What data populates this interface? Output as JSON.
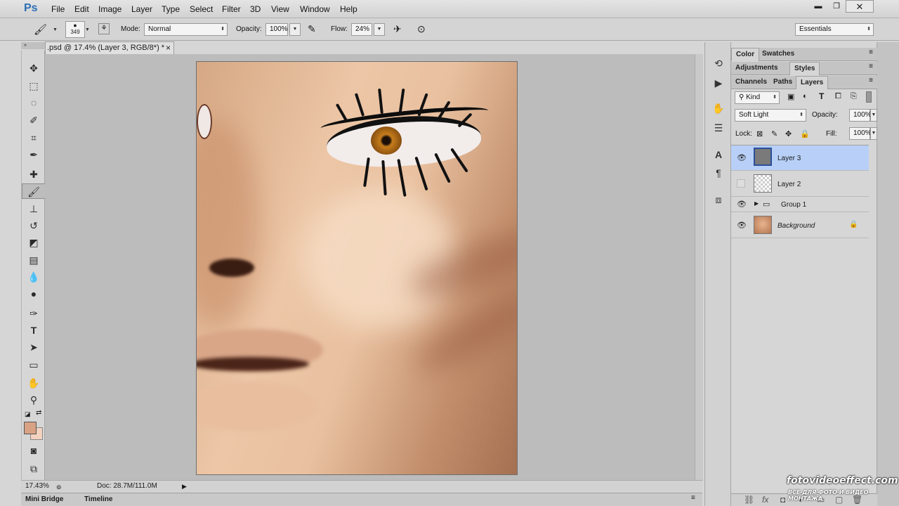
{
  "app": {
    "logo": "Ps"
  },
  "menu": [
    "File",
    "Edit",
    "Image",
    "Layer",
    "Type",
    "Select",
    "Filter",
    "3D",
    "View",
    "Window",
    "Help"
  ],
  "window_controls": {
    "minimize": "▬",
    "restore": "❐",
    "close": "✕"
  },
  "options": {
    "brush_size": "349",
    "mode_label": "Mode:",
    "mode_value": "Normal",
    "opacity_label": "Opacity:",
    "opacity_value": "100%",
    "flow_label": "Flow:",
    "flow_value": "24%",
    "workspace": "Essentials"
  },
  "document": {
    "tab_title": ".psd @ 17.4% (Layer 3, RGB/8*) *",
    "tab_close": "×"
  },
  "status": {
    "zoom": "17.43%",
    "doc_info": "Doc: 28.7M/111.0M"
  },
  "bottom_tabs": [
    "Mini Bridge",
    "Timeline"
  ],
  "panels": {
    "row1": [
      "Color",
      "Swatches"
    ],
    "row2": [
      "Adjustments",
      "Styles"
    ],
    "row3": [
      "Channels",
      "Paths",
      "Layers"
    ],
    "filter_kind": "Kind",
    "blend_mode": "Soft Light",
    "opacity_label": "Opacity:",
    "opacity_value": "100%",
    "lock_label": "Lock:",
    "fill_label": "Fill:",
    "fill_value": "100%"
  },
  "layers": [
    {
      "name": "Layer 3",
      "visible": true,
      "selected": true
    },
    {
      "name": "Layer 2",
      "visible": false,
      "selected": false
    },
    {
      "name": "Group 1",
      "visible": true,
      "selected": false
    },
    {
      "name": "Background",
      "visible": true,
      "selected": false
    }
  ],
  "layer_footer_icons": [
    "⛓",
    "fx",
    "◘",
    "◐",
    "▭",
    "▢",
    "🗑"
  ],
  "watermark": {
    "line1": "fotovideoeffect.com",
    "line2": "ВСЕ ДЛЯ ФОТО И ВИДЕО МОНТАЖА"
  },
  "colors": {
    "foreground": "#d9a285",
    "background": "#f3d2bf",
    "selection": "#b8d0f7"
  }
}
